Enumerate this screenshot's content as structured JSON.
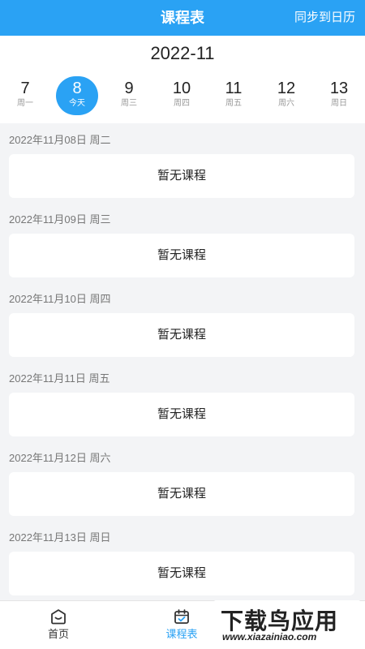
{
  "header": {
    "title": "课程表",
    "sync_label": "同步到日历",
    "color": "#2aa2f4"
  },
  "calendar": {
    "month": "2022-11",
    "days": [
      {
        "num": "7",
        "week": "周一",
        "today": false
      },
      {
        "num": "8",
        "week": "今天",
        "today": true
      },
      {
        "num": "9",
        "week": "周三",
        "today": false
      },
      {
        "num": "10",
        "week": "周四",
        "today": false
      },
      {
        "num": "11",
        "week": "周五",
        "today": false
      },
      {
        "num": "12",
        "week": "周六",
        "today": false
      },
      {
        "num": "13",
        "week": "周日",
        "today": false
      }
    ]
  },
  "schedule": [
    {
      "date": "2022年11月08日 周二",
      "content": "暂无课程"
    },
    {
      "date": "2022年11月09日 周三",
      "content": "暂无课程"
    },
    {
      "date": "2022年11月10日 周四",
      "content": "暂无课程"
    },
    {
      "date": "2022年11月11日 周五",
      "content": "暂无课程"
    },
    {
      "date": "2022年11月12日 周六",
      "content": "暂无课程"
    },
    {
      "date": "2022年11月13日 周日",
      "content": "暂无课程"
    }
  ],
  "tabbar": {
    "tabs": [
      {
        "label": "首页",
        "icon": "home-icon",
        "active": false
      },
      {
        "label": "课程表",
        "icon": "calendar-icon",
        "active": true
      }
    ]
  },
  "watermark": {
    "text": "下载鸟应用",
    "url": "www.xiazainiao.com"
  }
}
